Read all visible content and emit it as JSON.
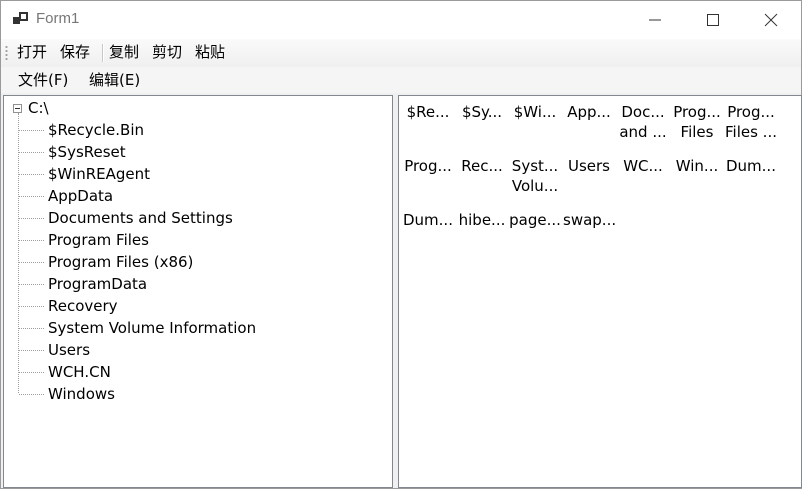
{
  "window": {
    "title": "Form1"
  },
  "toolbar": {
    "items": [
      "打开",
      "保存",
      "复制",
      "剪切",
      "粘贴"
    ]
  },
  "menu": {
    "items": [
      "文件(F)",
      "编辑(E)"
    ]
  },
  "tree": {
    "root": "C:\\",
    "children": [
      "$Recycle.Bin",
      "$SysReset",
      "$WinREAgent",
      "AppData",
      "Documents and Settings",
      "Program Files",
      "Program Files (x86)",
      "ProgramData",
      "Recovery",
      "System Volume Information",
      "Users",
      "WCH.CN",
      "Windows"
    ]
  },
  "listview": {
    "items": [
      {
        "line1": "$Re...",
        "line2": ""
      },
      {
        "line1": "$Sy...",
        "line2": ""
      },
      {
        "line1": "$Wi...",
        "line2": ""
      },
      {
        "line1": "App...",
        "line2": ""
      },
      {
        "line1": "Doc...",
        "line2": "and ..."
      },
      {
        "line1": "Prog...",
        "line2": "Files"
      },
      {
        "line1": "Prog...",
        "line2": "Files ..."
      },
      {
        "line1": "Prog...",
        "line2": ""
      },
      {
        "line1": "Rec...",
        "line2": ""
      },
      {
        "line1": "Syst...",
        "line2": "Volu..."
      },
      {
        "line1": "Users",
        "line2": ""
      },
      {
        "line1": "WC...",
        "line2": ""
      },
      {
        "line1": "Win...",
        "line2": ""
      },
      {
        "line1": "Dum...",
        "line2": ""
      },
      {
        "line1": "Dum...",
        "line2": ""
      },
      {
        "line1": "hibe...",
        "line2": ""
      },
      {
        "line1": "page...",
        "line2": ""
      },
      {
        "line1": "swap...",
        "line2": ""
      }
    ]
  }
}
